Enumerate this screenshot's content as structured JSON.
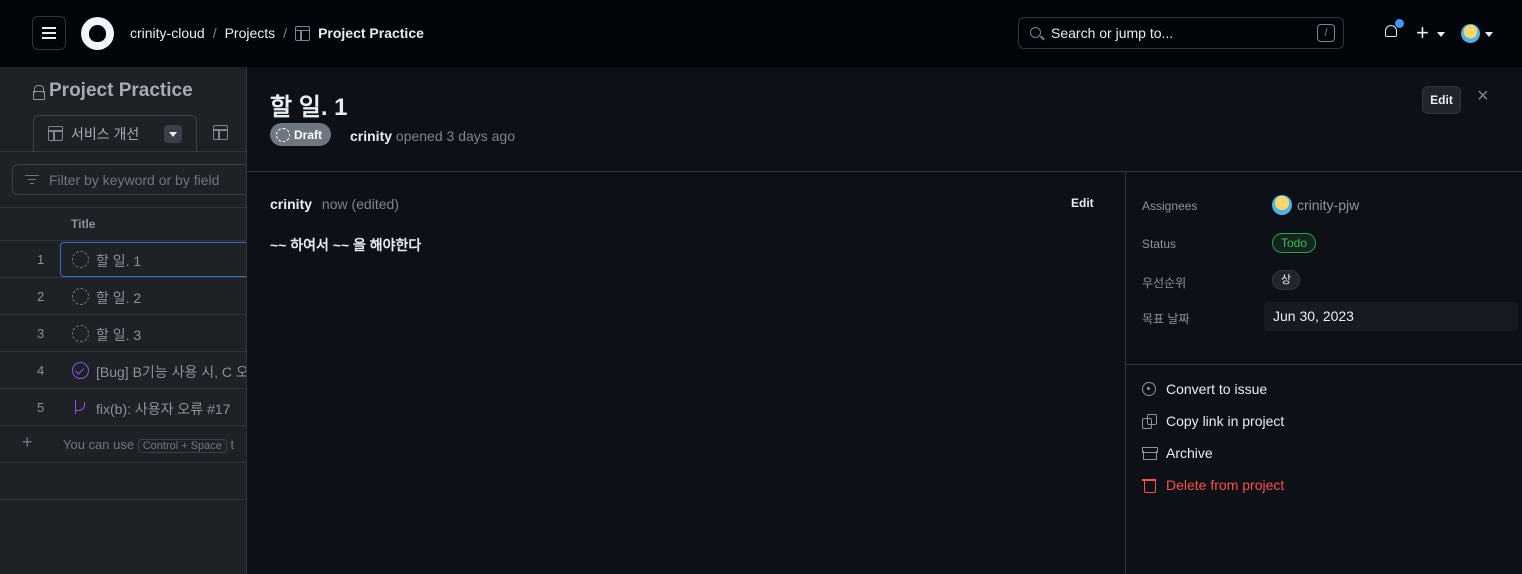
{
  "header": {
    "org": "crinity-cloud",
    "projects": "Projects",
    "project_name": "Project Practice",
    "search_placeholder": "Search or jump to...",
    "search_shortcut": "/",
    "plus": "+"
  },
  "background": {
    "title": "Project Practice",
    "tab_label": "서비스 개선",
    "filter_placeholder": "Filter by keyword or by field",
    "column_title": "Title",
    "rows": [
      {
        "num": "1",
        "title": "할 일. 1"
      },
      {
        "num": "2",
        "title": "할 일. 2"
      },
      {
        "num": "3",
        "title": "할 일. 3"
      },
      {
        "num": "4",
        "title": "[Bug] B기능 사용 시, C 오"
      },
      {
        "num": "5",
        "title": "fix(b): 사용자 오류 #17"
      }
    ],
    "add_hint_prefix": "You can use",
    "add_hint_kbd": "Control + Space",
    "add_hint_suffix": "t"
  },
  "panel": {
    "title": "할 일. 1",
    "status_badge": "Draft",
    "author": "crinity",
    "opened_text": "opened 3 days ago",
    "edit_label": "Edit",
    "close_glyph": "×",
    "comment": {
      "author": "crinity",
      "time": "now (edited)",
      "edit_label": "Edit",
      "body": "~~ 하여서 ~~ 을 해야한다"
    },
    "fields": {
      "assignees_label": "Assignees",
      "assignee": "crinity-pjw",
      "status_label": "Status",
      "status": "Todo",
      "priority_label": "우선순위",
      "priority": "상",
      "date_label": "목표 날짜",
      "date": "Jun 30, 2023"
    },
    "actions": {
      "convert": "Convert to issue",
      "copy_link": "Copy link in project",
      "archive": "Archive",
      "delete": "Delete from project"
    }
  },
  "colors": {
    "accent": "#4493f8",
    "todo_green": "#3fb950",
    "danger": "#f85149",
    "purple": "#8957e5"
  }
}
